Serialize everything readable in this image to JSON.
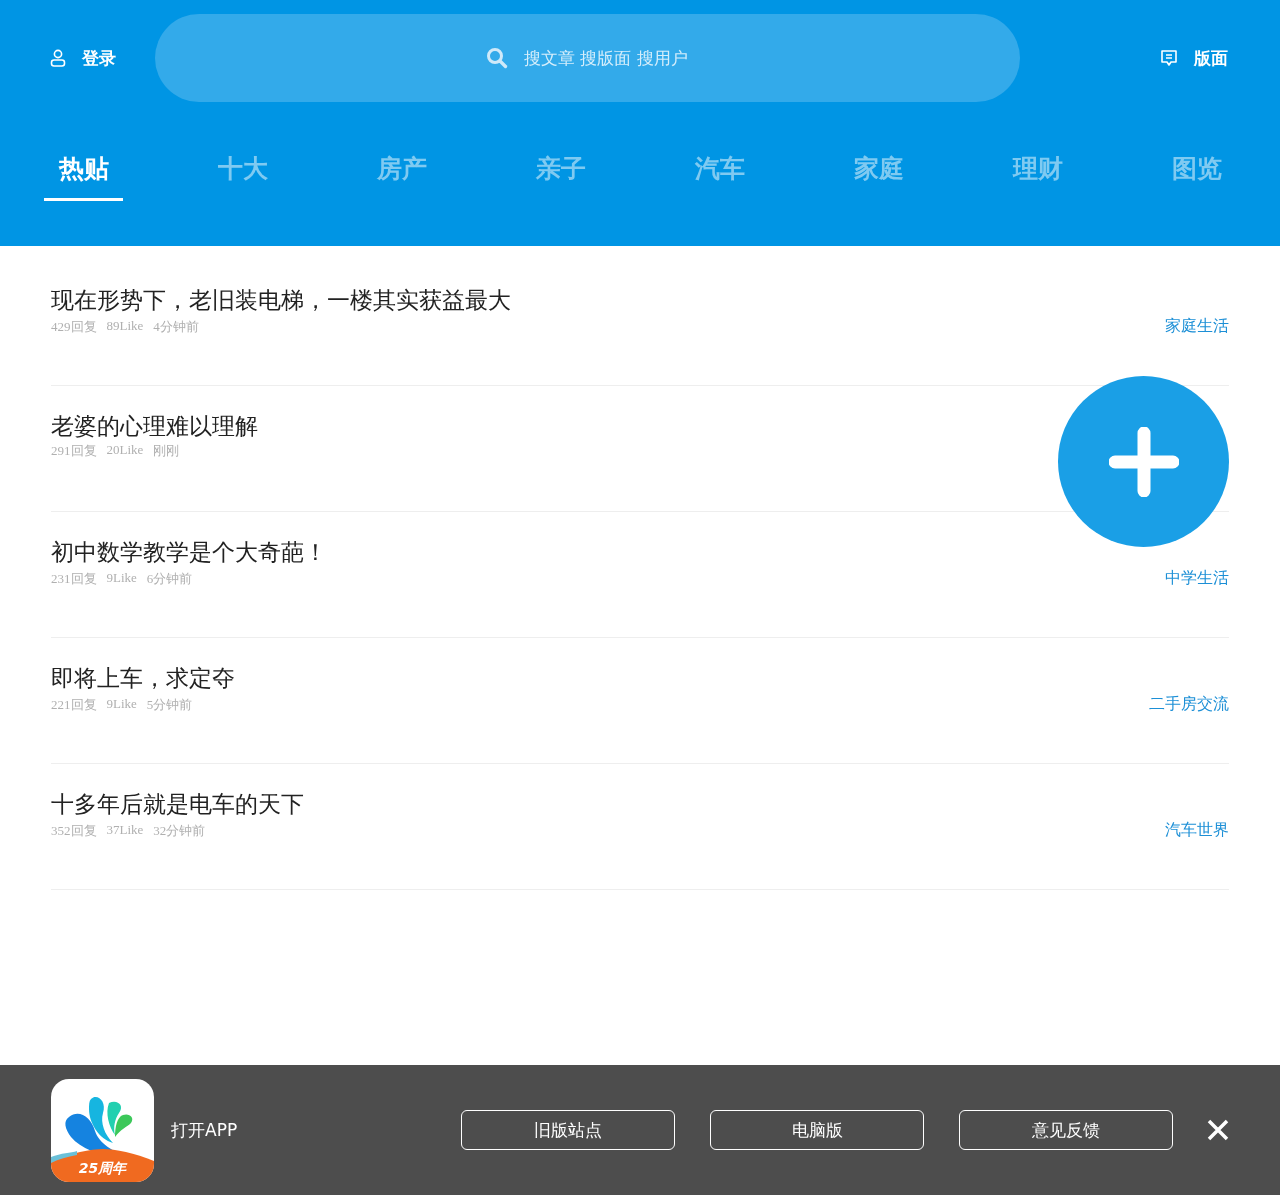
{
  "header": {
    "login": "登录",
    "search": {
      "placeholder": "搜文章 搜版面 搜用户"
    },
    "boards": "版面"
  },
  "tabs": [
    {
      "label": "热贴",
      "selected": true
    },
    {
      "label": "十大",
      "selected": false
    },
    {
      "label": "房产",
      "selected": false
    },
    {
      "label": "亲子",
      "selected": false
    },
    {
      "label": "汽车",
      "selected": false
    },
    {
      "label": "家庭",
      "selected": false
    },
    {
      "label": "理财",
      "selected": false
    },
    {
      "label": "图览",
      "selected": false
    }
  ],
  "posts": [
    {
      "title": "现在形势下，老旧装电梯，一楼其实获益最大",
      "replies": "429回复",
      "likes": "89Like",
      "time": "4分钟前",
      "board": "家庭生活"
    },
    {
      "title": "老婆的心理难以理解",
      "replies": "291回复",
      "likes": "20Like",
      "time": "刚刚"
    },
    {
      "title": "初中数学教学是个大奇葩！",
      "replies": "231回复",
      "likes": "9Like",
      "time": "6分钟前",
      "board": "中学生活"
    },
    {
      "title": "即将上车，求定夺",
      "replies": "221回复",
      "likes": "9Like",
      "time": "5分钟前",
      "board": "二手房交流"
    },
    {
      "title": "十多年后就是电车的天下",
      "replies": "352回复",
      "likes": "37Like",
      "time": "32分钟前",
      "board": "汽车世界"
    }
  ],
  "app_bar": {
    "app_badge": "25周年",
    "open_app": "打开APP",
    "buttons": [
      "旧版站点",
      "电脑版",
      "意见反馈"
    ]
  }
}
